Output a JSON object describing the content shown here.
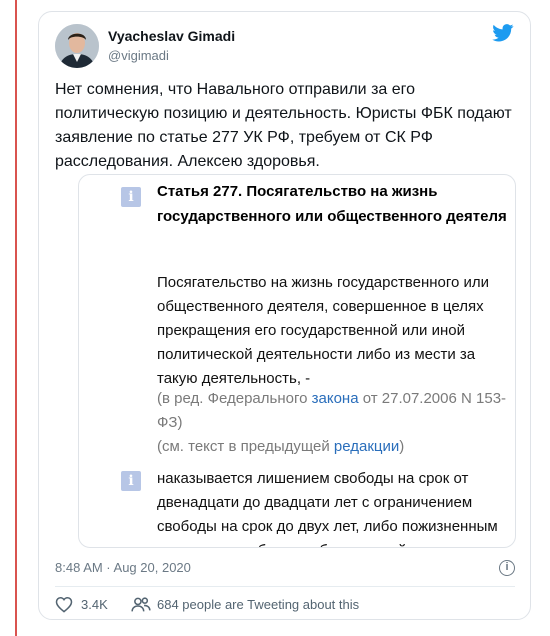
{
  "tweet": {
    "author_name": "Vyacheslav Gimadi",
    "author_handle": "@vigimadi",
    "text": "Нет сомнения, что Навального отправили за его политическую позицию и деятельность. Юристы ФБК подают заявление по статье 277 УК РФ, требуем от СК РФ расследования. Алексею здоровья.",
    "timestamp": "8:48 AM · Aug 20, 2020",
    "likes": "3.4K",
    "tweeting_about": "684 people are Tweeting about this"
  },
  "quote": {
    "title": "Статья 277. Посягательство на жизнь государственного или общественного деятеля",
    "body": "Посягательство на жизнь государственного или общественного деятеля, совершенное в целях прекращения его государственной или иной политической деятельности либо из мести за такую деятельность, -",
    "note1_prefix": "(в ред. Федерального ",
    "note1_link": "закона",
    "note1_suffix": " от 27.07.2006 N 153-ФЗ)",
    "note2_prefix": "(см. текст в предыдущей ",
    "note2_link": "редакции",
    "note2_suffix": ")",
    "punishment": "наказывается лишением свободы на срок от двенадцати до двадцати лет с ограничением свободы на срок до двух лет, либо пожизненным лишением свободы, либо смертной казнью.",
    "info_icon_glyph": "i"
  },
  "icons": {
    "twitter": "twitter-bird-icon",
    "info": "info-icon",
    "heart": "heart-icon",
    "people": "people-icon"
  },
  "colors": {
    "twitter_blue": "#1d9bf0",
    "link": "#2a6ebb",
    "info_badge": "#b7c6e6",
    "muted": "#6b7985"
  }
}
